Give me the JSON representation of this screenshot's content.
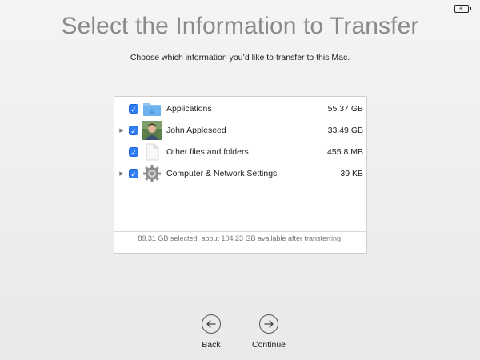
{
  "title": "Select the Information to Transfer",
  "subtitle": "Choose which information you’d like to transfer to this Mac.",
  "items": [
    {
      "label": "Applications",
      "size": "55.37 GB",
      "checked": true,
      "expandable": false,
      "icon": "applications-folder-icon"
    },
    {
      "label": "John Appleseed",
      "size": "33.49 GB",
      "checked": true,
      "expandable": true,
      "icon": "user-photo-icon"
    },
    {
      "label": "Other files and folders",
      "size": "455.8 MB",
      "checked": true,
      "expandable": false,
      "icon": "document-icon"
    },
    {
      "label": "Computer & Network Settings",
      "size": "39 KB",
      "checked": true,
      "expandable": true,
      "icon": "gear-icon"
    }
  ],
  "summary": "89.31 GB selected, about 104.23 GB available after transferring.",
  "nav": {
    "back_label": "Back",
    "continue_label": "Continue"
  },
  "colors": {
    "accent": "#2f7df6",
    "title": "#8a8a8a",
    "background": "#eeeeee"
  }
}
